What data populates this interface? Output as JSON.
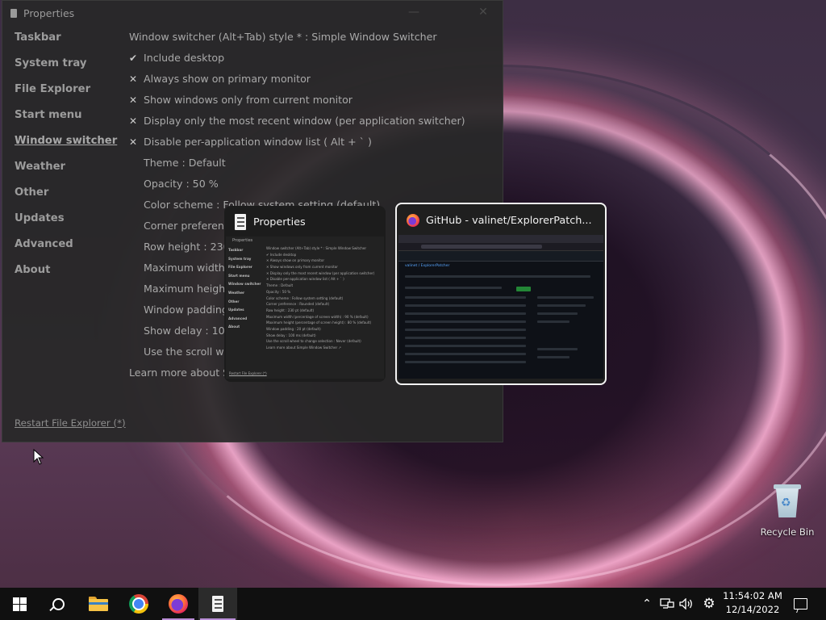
{
  "properties_window": {
    "title": "Properties",
    "minimize_glyph": "—",
    "close_glyph": "✕",
    "nav": [
      {
        "label": "Taskbar",
        "active": false
      },
      {
        "label": "System tray",
        "active": false
      },
      {
        "label": "File Explorer",
        "active": false
      },
      {
        "label": "Start menu",
        "active": false
      },
      {
        "label": "Window switcher",
        "active": true
      },
      {
        "label": "Weather",
        "active": false
      },
      {
        "label": "Other",
        "active": false
      },
      {
        "label": "Updates",
        "active": false
      },
      {
        "label": "Advanced",
        "active": false
      },
      {
        "label": "About",
        "active": false
      }
    ],
    "settings": {
      "style": "Window switcher (Alt+Tab) style * : Simple Window Switcher",
      "include_desktop": {
        "mark": "✔",
        "label": "Include desktop"
      },
      "always_primary": {
        "mark": "✕",
        "label": "Always show on primary monitor"
      },
      "current_monitor": {
        "mark": "✕",
        "label": "Show windows only from current monitor"
      },
      "most_recent": {
        "mark": "✕",
        "label": "Display only the most recent window (per application switcher)"
      },
      "disable_per_app": {
        "mark": "✕",
        "label": "Disable per-application window list ( Alt + ` )"
      },
      "theme": "Theme : Default",
      "opacity": "Opacity : 50 %",
      "color_scheme": "Color scheme : Follow system setting (default)",
      "corner_preference": "Corner preference : R",
      "row_height": "Row height : 230 pt",
      "max_width": "Maximum width (p",
      "max_height": "Maximum height (p",
      "window_padding": "Window padding : 2",
      "show_delay": "Show delay : 100 ms",
      "scroll_wheel": "Use the scroll wheel",
      "learn_more": "Learn more about Simp"
    },
    "restart_link": "Restart File Explorer (*)"
  },
  "switcher": {
    "thumbnails": [
      {
        "title": "Properties",
        "icon": "properties-app-icon"
      },
      {
        "title": "GitHub - valinet/ExplorerPatch...",
        "icon": "firefox-icon"
      }
    ],
    "mini_properties": {
      "title": "Properties",
      "nav": [
        "Taskbar",
        "System tray",
        "File Explorer",
        "Start menu",
        "Window switcher",
        "Weather",
        "Other",
        "Updates",
        "Advanced",
        "About"
      ],
      "settings": [
        "Window switcher (Alt+Tab) style * : Simple Window Switcher",
        "✔ Include desktop",
        "✕ Always show on primary monitor",
        "✕ Show windows only from current monitor",
        "✕ Display only the most recent window (per application switcher)",
        "✕ Disable per-application window list ( Alt + ` )",
        "Theme : Default",
        "Opacity : 50 %",
        "Color scheme : Follow system setting (default)",
        "Corner preference : Rounded (default)",
        "Row height : 230 pt (default)",
        "Maximum width (percentage of screen width) : 90 % (default)",
        "Maximum height (percentage of screen height) : 80 % (default)",
        "Window padding : 20 pt (default)",
        "Show delay : 100 ms (default)",
        "Use the scroll wheel to change selection : Never (default)",
        "Learn more about Simple Window Switcher ↗"
      ],
      "footer": "Restart File Explorer (*)"
    },
    "mini_github": {
      "repo": "valinet / ExplorerPatcher"
    }
  },
  "desktop": {
    "recycle_bin_label": "Recycle Bin"
  },
  "taskbar": {
    "clock_time": "11:54:02 AM",
    "clock_date": "12/14/2022",
    "tray_chevron": "⌃",
    "settings_glyph": "⚙",
    "accent": "#b98ed6"
  }
}
